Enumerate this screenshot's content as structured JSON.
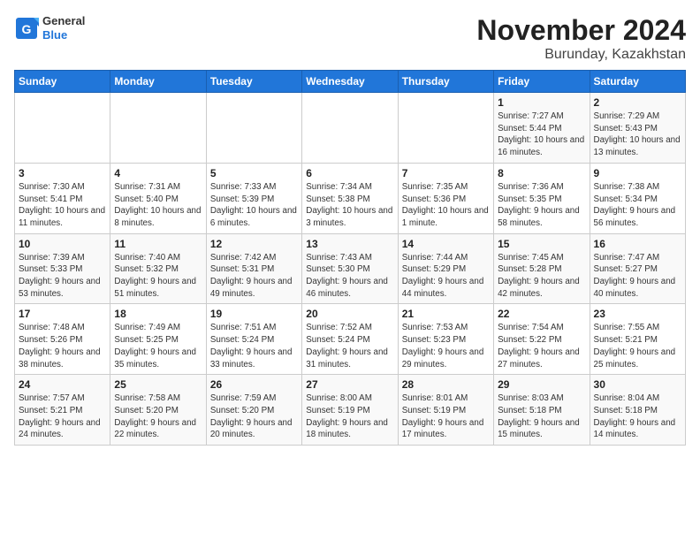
{
  "logo": {
    "general": "General",
    "blue": "Blue"
  },
  "title": "November 2024",
  "subtitle": "Burunday, Kazakhstan",
  "days_of_week": [
    "Sunday",
    "Monday",
    "Tuesday",
    "Wednesday",
    "Thursday",
    "Friday",
    "Saturday"
  ],
  "weeks": [
    [
      {
        "day": "",
        "info": ""
      },
      {
        "day": "",
        "info": ""
      },
      {
        "day": "",
        "info": ""
      },
      {
        "day": "",
        "info": ""
      },
      {
        "day": "",
        "info": ""
      },
      {
        "day": "1",
        "info": "Sunrise: 7:27 AM\nSunset: 5:44 PM\nDaylight: 10 hours and 16 minutes."
      },
      {
        "day": "2",
        "info": "Sunrise: 7:29 AM\nSunset: 5:43 PM\nDaylight: 10 hours and 13 minutes."
      }
    ],
    [
      {
        "day": "3",
        "info": "Sunrise: 7:30 AM\nSunset: 5:41 PM\nDaylight: 10 hours and 11 minutes."
      },
      {
        "day": "4",
        "info": "Sunrise: 7:31 AM\nSunset: 5:40 PM\nDaylight: 10 hours and 8 minutes."
      },
      {
        "day": "5",
        "info": "Sunrise: 7:33 AM\nSunset: 5:39 PM\nDaylight: 10 hours and 6 minutes."
      },
      {
        "day": "6",
        "info": "Sunrise: 7:34 AM\nSunset: 5:38 PM\nDaylight: 10 hours and 3 minutes."
      },
      {
        "day": "7",
        "info": "Sunrise: 7:35 AM\nSunset: 5:36 PM\nDaylight: 10 hours and 1 minute."
      },
      {
        "day": "8",
        "info": "Sunrise: 7:36 AM\nSunset: 5:35 PM\nDaylight: 9 hours and 58 minutes."
      },
      {
        "day": "9",
        "info": "Sunrise: 7:38 AM\nSunset: 5:34 PM\nDaylight: 9 hours and 56 minutes."
      }
    ],
    [
      {
        "day": "10",
        "info": "Sunrise: 7:39 AM\nSunset: 5:33 PM\nDaylight: 9 hours and 53 minutes."
      },
      {
        "day": "11",
        "info": "Sunrise: 7:40 AM\nSunset: 5:32 PM\nDaylight: 9 hours and 51 minutes."
      },
      {
        "day": "12",
        "info": "Sunrise: 7:42 AM\nSunset: 5:31 PM\nDaylight: 9 hours and 49 minutes."
      },
      {
        "day": "13",
        "info": "Sunrise: 7:43 AM\nSunset: 5:30 PM\nDaylight: 9 hours and 46 minutes."
      },
      {
        "day": "14",
        "info": "Sunrise: 7:44 AM\nSunset: 5:29 PM\nDaylight: 9 hours and 44 minutes."
      },
      {
        "day": "15",
        "info": "Sunrise: 7:45 AM\nSunset: 5:28 PM\nDaylight: 9 hours and 42 minutes."
      },
      {
        "day": "16",
        "info": "Sunrise: 7:47 AM\nSunset: 5:27 PM\nDaylight: 9 hours and 40 minutes."
      }
    ],
    [
      {
        "day": "17",
        "info": "Sunrise: 7:48 AM\nSunset: 5:26 PM\nDaylight: 9 hours and 38 minutes."
      },
      {
        "day": "18",
        "info": "Sunrise: 7:49 AM\nSunset: 5:25 PM\nDaylight: 9 hours and 35 minutes."
      },
      {
        "day": "19",
        "info": "Sunrise: 7:51 AM\nSunset: 5:24 PM\nDaylight: 9 hours and 33 minutes."
      },
      {
        "day": "20",
        "info": "Sunrise: 7:52 AM\nSunset: 5:24 PM\nDaylight: 9 hours and 31 minutes."
      },
      {
        "day": "21",
        "info": "Sunrise: 7:53 AM\nSunset: 5:23 PM\nDaylight: 9 hours and 29 minutes."
      },
      {
        "day": "22",
        "info": "Sunrise: 7:54 AM\nSunset: 5:22 PM\nDaylight: 9 hours and 27 minutes."
      },
      {
        "day": "23",
        "info": "Sunrise: 7:55 AM\nSunset: 5:21 PM\nDaylight: 9 hours and 25 minutes."
      }
    ],
    [
      {
        "day": "24",
        "info": "Sunrise: 7:57 AM\nSunset: 5:21 PM\nDaylight: 9 hours and 24 minutes."
      },
      {
        "day": "25",
        "info": "Sunrise: 7:58 AM\nSunset: 5:20 PM\nDaylight: 9 hours and 22 minutes."
      },
      {
        "day": "26",
        "info": "Sunrise: 7:59 AM\nSunset: 5:20 PM\nDaylight: 9 hours and 20 minutes."
      },
      {
        "day": "27",
        "info": "Sunrise: 8:00 AM\nSunset: 5:19 PM\nDaylight: 9 hours and 18 minutes."
      },
      {
        "day": "28",
        "info": "Sunrise: 8:01 AM\nSunset: 5:19 PM\nDaylight: 9 hours and 17 minutes."
      },
      {
        "day": "29",
        "info": "Sunrise: 8:03 AM\nSunset: 5:18 PM\nDaylight: 9 hours and 15 minutes."
      },
      {
        "day": "30",
        "info": "Sunrise: 8:04 AM\nSunset: 5:18 PM\nDaylight: 9 hours and 14 minutes."
      }
    ]
  ]
}
